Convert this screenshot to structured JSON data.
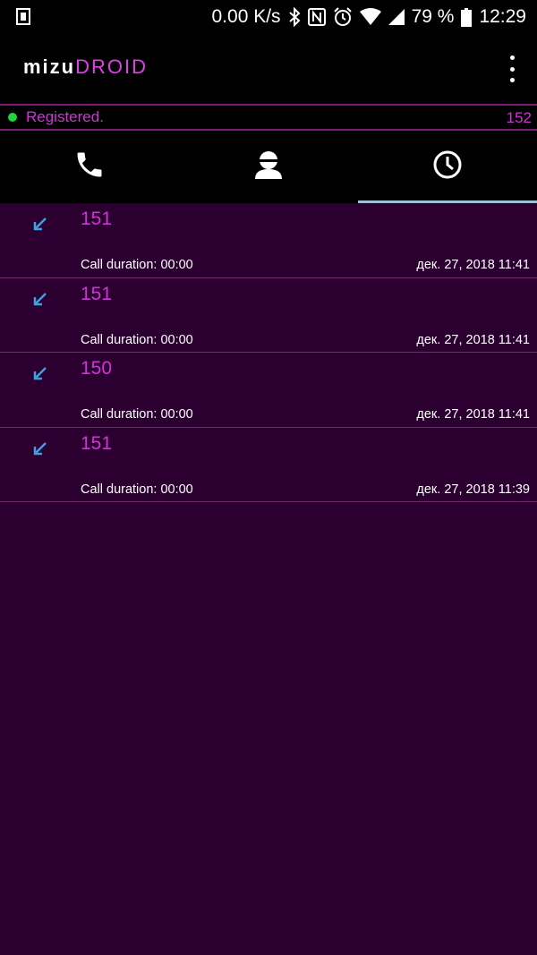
{
  "status_bar": {
    "network_speed": "0.00 K/s",
    "battery_percent": "79 %",
    "time": "12:29",
    "icons": [
      "sim-card-icon",
      "bluetooth-icon",
      "nfc-icon",
      "alarm-icon",
      "wifi-icon",
      "signal-icon",
      "battery-icon"
    ]
  },
  "app_bar": {
    "logo_part1": "mizu",
    "logo_part2": "DROID",
    "menu_icon": "overflow-menu-icon"
  },
  "registration": {
    "status": "Registered.",
    "account_number": "152",
    "status_color": "#22d33a"
  },
  "tabs": [
    {
      "icon": "phone-icon",
      "active": false
    },
    {
      "icon": "contact-icon",
      "active": false
    },
    {
      "icon": "clock-icon",
      "active": true
    }
  ],
  "call_log": [
    {
      "number": "151",
      "duration": "Call duration: 00:00",
      "date": "дек. 27, 2018 11:41",
      "icon": "incoming-call-icon"
    },
    {
      "number": "151",
      "duration": "Call duration: 00:00",
      "date": "дек. 27, 2018 11:41",
      "icon": "incoming-call-icon"
    },
    {
      "number": "150",
      "duration": "Call duration: 00:00",
      "date": "дек. 27, 2018 11:41",
      "icon": "incoming-call-icon"
    },
    {
      "number": "151",
      "duration": "Call duration: 00:00",
      "date": "дек. 27, 2018 11:39",
      "icon": "incoming-call-icon"
    }
  ],
  "colors": {
    "background": "#2b0030",
    "accent": "#d033d8",
    "tab_indicator": "#9fbfd6",
    "incoming_arrow": "#3f9fe0"
  }
}
